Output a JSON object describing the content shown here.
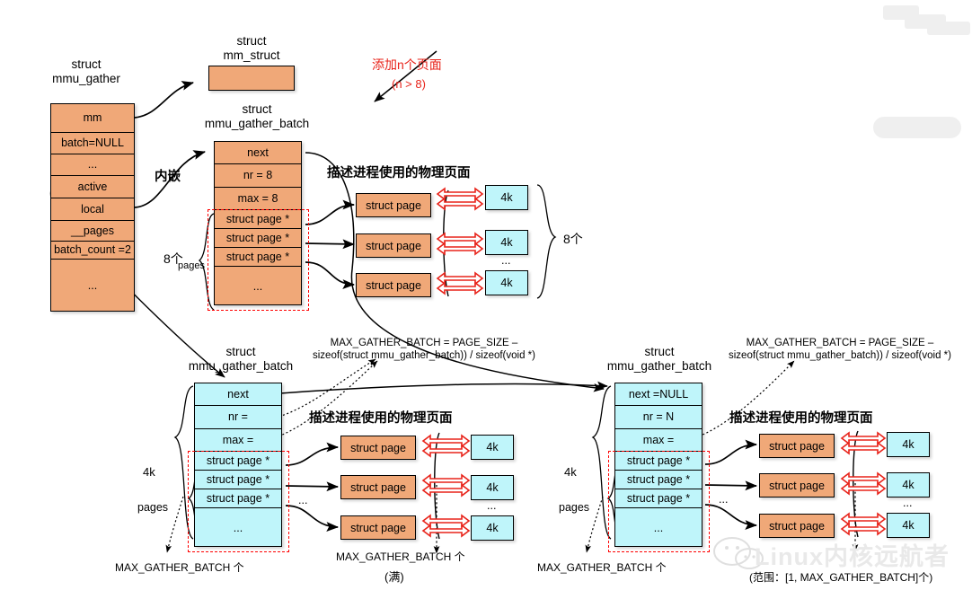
{
  "diagram": {
    "title_hint": "Linux mmu_gather / mmu_gather_batch structure diagram",
    "watermark": {
      "brand": "Linux内核远航者",
      "footnote": "(范围：[1, MAX_GATHER_BATCH]个)"
    },
    "annotations": {
      "add_pages_red": "添加n个页面",
      "add_pages_cond": "(n > 8)",
      "embedded": "内嵌",
      "eight_count": "8个",
      "eight_pages_num": "8个",
      "eight_pages_word": "pages",
      "pages_word": "pages",
      "size_4k": "4k",
      "max_gather_batch_count": "MAX_GATHER_BATCH 个",
      "full_marker": "(满)",
      "physical_pages_desc": "描述进程使用的物理页面",
      "formula_line1": "MAX_GATHER_BATCH = PAGE_SIZE –",
      "formula_line2": "sizeof(struct mmu_gather_batch)) / sizeof(void *)"
    },
    "structs": {
      "mmu_gather": {
        "caption": "struct\nmmu_gather",
        "fields": [
          "mm",
          "batch=NULL",
          "...",
          "active",
          "local",
          "__pages",
          "batch_count =2",
          "..."
        ]
      },
      "mm_struct": {
        "caption": "struct\nmm_struct",
        "fields": [
          ""
        ]
      },
      "batch_top": {
        "caption": "struct\nmmu_gather_batch",
        "fields": [
          "next",
          "nr = 8",
          "max = 8",
          "struct page *",
          "struct page *",
          "struct page *",
          "..."
        ]
      },
      "batch_mid": {
        "caption": "struct\nmmu_gather_batch",
        "fields": [
          "next",
          "nr =",
          "max =",
          "struct page *",
          "struct page *",
          "struct page *",
          "..."
        ]
      },
      "batch_right": {
        "caption": "struct\nmmu_gather_batch",
        "fields": [
          "next =NULL",
          "nr = N",
          "max =",
          "struct page *",
          "struct page *",
          "struct page *",
          "..."
        ]
      }
    },
    "page_groups": {
      "top": {
        "pages": [
          "struct page",
          "struct page",
          "struct page"
        ],
        "frames": [
          "4k",
          "4k",
          "4k"
        ],
        "ellipsis": "...",
        "brace_label": "8个"
      },
      "mid": {
        "pages": [
          "struct page",
          "struct page",
          "struct page"
        ],
        "frames": [
          "4k",
          "4k",
          "4k"
        ],
        "ellipsis": "..."
      },
      "right": {
        "pages": [
          "struct page",
          "struct page",
          "struct page"
        ],
        "frames": [
          "4k",
          "4k",
          "4k"
        ],
        "ellipsis": "..."
      }
    },
    "colors": {
      "orange": "#F0A878",
      "cyan": "#BFF5FA",
      "red_accent": "#E8231A",
      "dashed_red": "#FF0000",
      "outline": "#000000"
    }
  }
}
